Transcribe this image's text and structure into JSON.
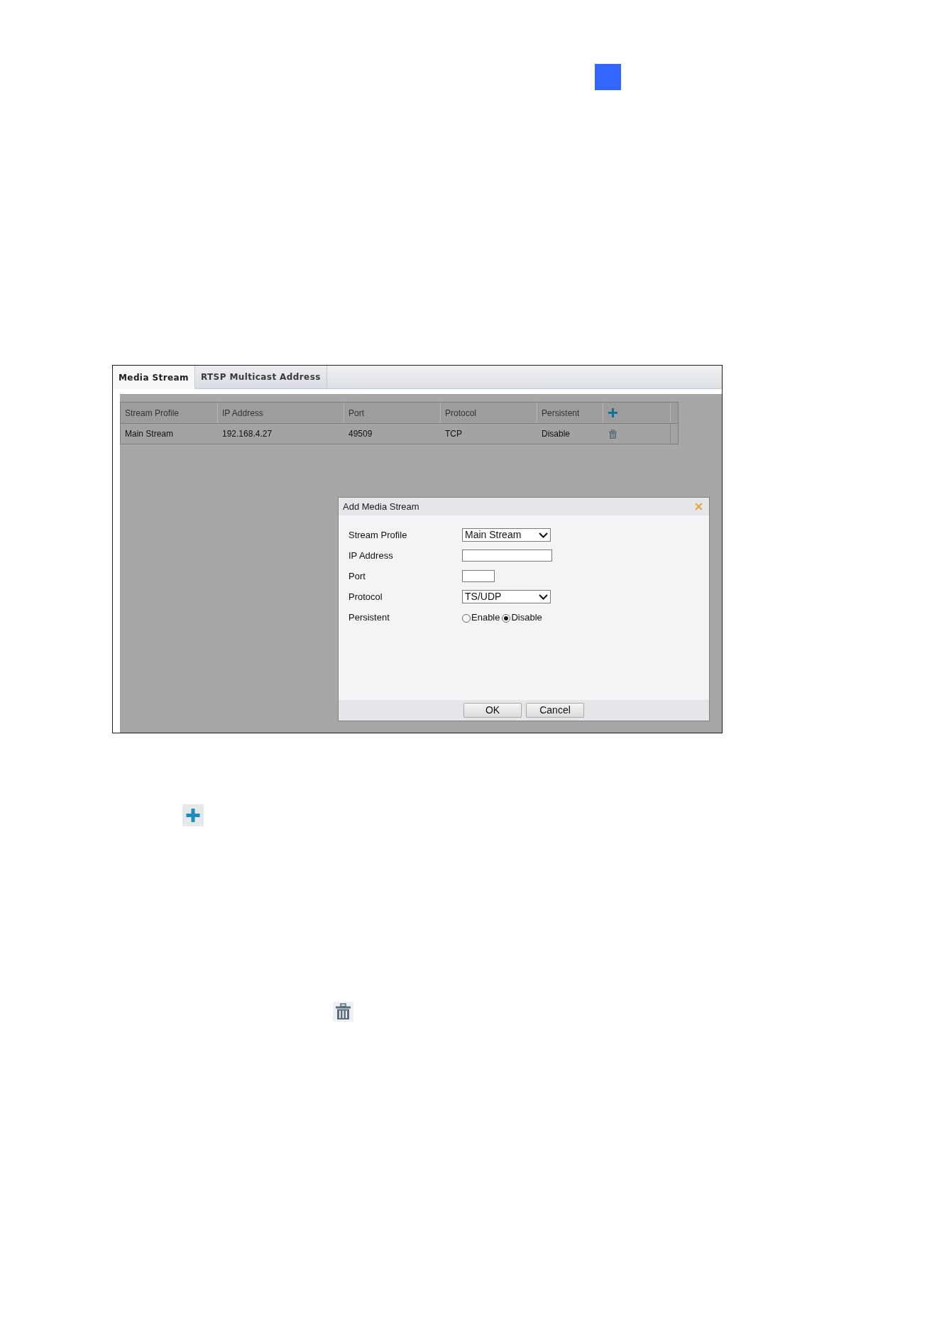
{
  "screenshot": {
    "tabs": [
      {
        "label": "Media Stream",
        "selected": true
      },
      {
        "label": "RTSP Multicast Address",
        "selected": false
      }
    ],
    "table": {
      "columns": [
        "Stream Profile",
        "IP Address",
        "Port",
        "Protocol",
        "Persistent"
      ],
      "rows": [
        {
          "cells": [
            "Main Stream",
            "192.168.4.27",
            "49509",
            "TCP",
            "Disable"
          ]
        }
      ]
    },
    "dialog": {
      "title": "Add Media Stream",
      "fields": [
        {
          "kind": "select",
          "label": "Stream Profile",
          "value": "Main Stream"
        },
        {
          "kind": "text",
          "label": "IP Address"
        },
        {
          "kind": "number",
          "label": "Port"
        },
        {
          "kind": "select",
          "label": "Protocol",
          "value": "TS/UDP"
        },
        {
          "kind": "radio",
          "label": "Persistent",
          "options": [
            {
              "label": "Enable",
              "selected": false
            },
            {
              "label": "Disable",
              "selected": true
            }
          ]
        }
      ],
      "buttons": [
        "OK",
        "Cancel"
      ]
    }
  }
}
